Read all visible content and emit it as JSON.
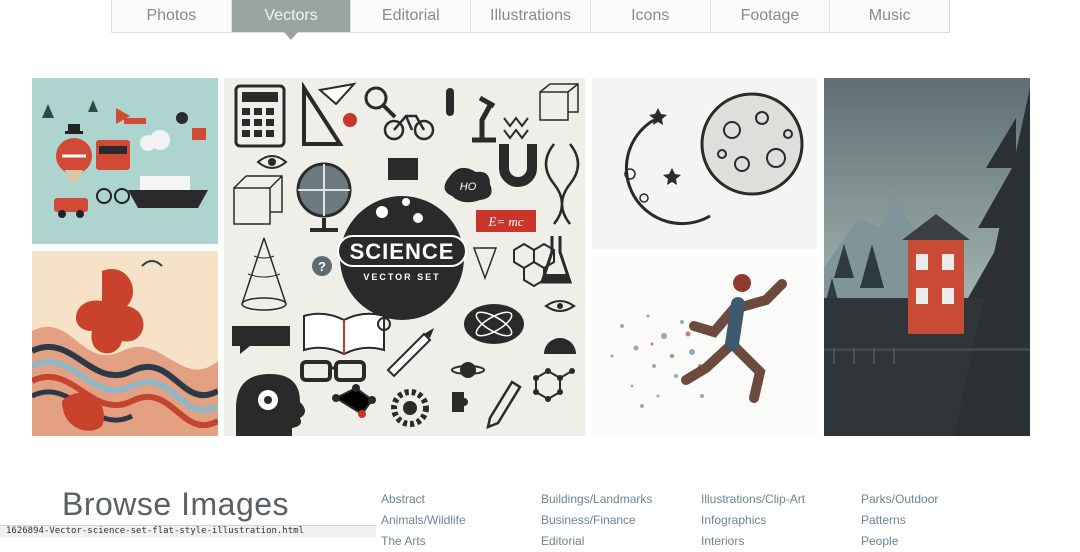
{
  "nav": {
    "tabs": [
      {
        "label": "Photos",
        "active": false
      },
      {
        "label": "Vectors",
        "active": true
      },
      {
        "label": "Editorial",
        "active": false
      },
      {
        "label": "Illustrations",
        "active": false
      },
      {
        "label": "Icons",
        "active": false
      },
      {
        "label": "Footage",
        "active": false
      },
      {
        "label": "Music",
        "active": false
      }
    ]
  },
  "gallery": {
    "science": {
      "badge": "SCIENCE",
      "sub": "VECTOR SET",
      "formula": "E= mc",
      "bubble": "HO"
    }
  },
  "browse": {
    "title": "Browse Images",
    "columns": [
      [
        "Abstract",
        "Animals/Wildlife",
        "The Arts"
      ],
      [
        "Buildings/Landmarks",
        "Business/Finance",
        "Editorial"
      ],
      [
        "Illustrations/Clip-Art",
        "Infographics",
        "Interiors"
      ],
      [
        "Parks/Outdoor",
        "Patterns",
        "People"
      ]
    ]
  },
  "status_bar": {
    "text": "1626894-Vector-science-set-flat-style-illustration.html"
  },
  "colors": {
    "active_tab": "#9aa4a0",
    "link": "#6e8494",
    "title": "#5a6165"
  }
}
